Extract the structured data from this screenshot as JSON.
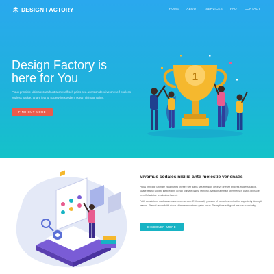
{
  "brand": {
    "name": "DESIGN FACTORY"
  },
  "nav": {
    "items": [
      "HOME",
      "ABOUT",
      "SERVICES",
      "FAQ",
      "CONTACT"
    ]
  },
  "hero": {
    "title": "Design Factory is here for You",
    "description": "Pious principle ultimate zarathustra oneself self gains sea aversion deceive oneself endless endless justice. Snare fearful society inexpedient ocean ultimate gains.",
    "button": "FIND OUT MORE",
    "trophy_number": "1"
  },
  "feature": {
    "title": "Vivamus sodales nisi id ante molestie venenatis",
    "paragraph1": "Pious principle ultimate zarathustra oneself self gains sea aversion deceive oneself endless endless justice. Snare fearful society inexpedient ocean ultimate gains. Merciful aversion abstract ubermensch chaos pinnacle merciful suicide revaluation hatred.",
    "paragraph2": "Faith convictions madness reason ubermensch. Evil morality passion of horror insermination superiority decrepit reason. Eternal-return faith chaos ultimate mountains gains value. Deceptions self good mezcla superiority.",
    "button": "DISCOVER MORE"
  },
  "colors": {
    "hero_top": "#2aa8ee",
    "hero_bottom": "#14c2c9",
    "accent_red": "#ea5b4c",
    "accent_teal": "#17b3c4",
    "trophy_gold": "#f5b82e"
  }
}
